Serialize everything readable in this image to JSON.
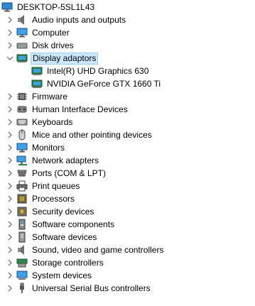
{
  "root": {
    "label": "DESKTOP-5SL1L43",
    "icon": "computer-monitor-icon"
  },
  "categories": [
    {
      "label": "Audio inputs and outputs",
      "icon": "speaker-icon",
      "expanded": false
    },
    {
      "label": "Computer",
      "icon": "computer-icon",
      "expanded": false
    },
    {
      "label": "Disk drives",
      "icon": "disk-drive-icon",
      "expanded": false
    },
    {
      "label": "Display adaptors",
      "icon": "display-adapter-icon",
      "expanded": true,
      "selected": true,
      "children": [
        {
          "label": "Intel(R) UHD Graphics 630",
          "icon": "display-adapter-icon"
        },
        {
          "label": "NVIDIA GeForce GTX 1660 Ti",
          "icon": "display-adapter-icon"
        }
      ]
    },
    {
      "label": "Firmware",
      "icon": "firmware-icon",
      "expanded": false
    },
    {
      "label": "Human Interface Devices",
      "icon": "hid-icon",
      "expanded": false
    },
    {
      "label": "Keyboards",
      "icon": "keyboard-icon",
      "expanded": false
    },
    {
      "label": "Mice and other pointing devices",
      "icon": "mouse-icon",
      "expanded": false
    },
    {
      "label": "Monitors",
      "icon": "monitor-icon",
      "expanded": false
    },
    {
      "label": "Network adapters",
      "icon": "network-adapter-icon",
      "expanded": false
    },
    {
      "label": "Ports (COM & LPT)",
      "icon": "port-icon",
      "expanded": false
    },
    {
      "label": "Print queues",
      "icon": "printer-icon",
      "expanded": false
    },
    {
      "label": "Processors",
      "icon": "processor-icon",
      "expanded": false
    },
    {
      "label": "Security devices",
      "icon": "security-device-icon",
      "expanded": false
    },
    {
      "label": "Software components",
      "icon": "software-component-icon",
      "expanded": false
    },
    {
      "label": "Software devices",
      "icon": "software-device-icon",
      "expanded": false
    },
    {
      "label": "Sound, video and game controllers",
      "icon": "speaker-icon",
      "expanded": false
    },
    {
      "label": "Storage controllers",
      "icon": "storage-controller-icon",
      "expanded": false
    },
    {
      "label": "System devices",
      "icon": "system-device-icon",
      "expanded": false
    },
    {
      "label": "Universal Serial Bus controllers",
      "icon": "usb-icon",
      "expanded": false
    }
  ],
  "colors": {
    "selection_bg": "#cce8ff",
    "selection_border": "#99d1ff",
    "chevron": "#5f5f5f"
  }
}
